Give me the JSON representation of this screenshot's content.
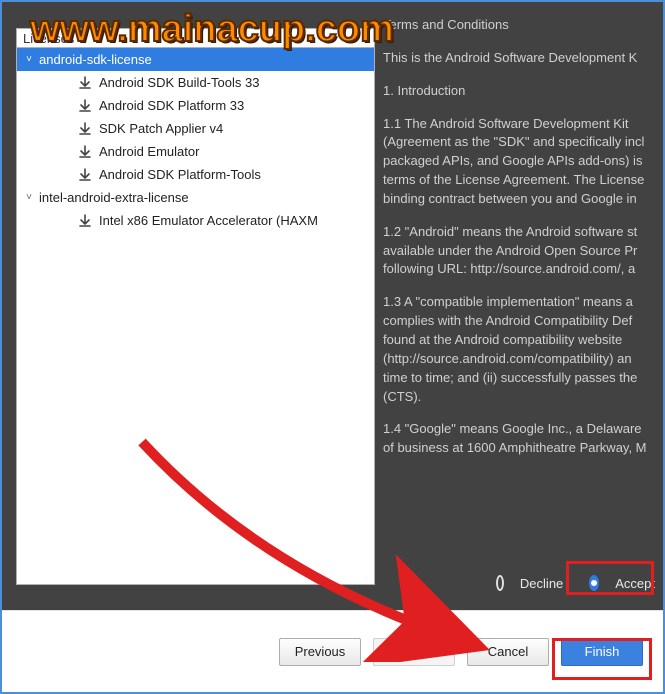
{
  "watermark": "www.mainacup.com",
  "left": {
    "title": "Licenses",
    "groups": [
      {
        "label": "android-sdk-license",
        "expanded": true,
        "selected": true,
        "items": [
          "Android SDK Build-Tools 33",
          "Android SDK Platform 33",
          "SDK Patch Applier v4",
          "Android Emulator",
          "Android SDK Platform-Tools"
        ]
      },
      {
        "label": "intel-android-extra-license",
        "expanded": true,
        "selected": false,
        "items": [
          "Intel x86 Emulator Accelerator (HAXM"
        ]
      }
    ]
  },
  "terms": {
    "heading": "Terms and Conditions",
    "line1": "This is the Android Software Development K",
    "sec1": "1. Introduction",
    "p11": "1.1 The Android Software Development Kit (Agreement as the \"SDK\" and specifically incl packaged APIs, and Google APIs add-ons) is terms of the License Agreement. The License binding contract between you and Google in",
    "p12": "1.2 \"Android\" means the Android software st available under the Android Open Source Pr following URL: http://source.android.com/, a",
    "p13": "1.3 A \"compatible implementation\" means a complies with the Android Compatibility Def found at the Android compatibility website (http://source.android.com/compatibility) an time to time; and (ii) successfully passes the (CTS).",
    "p14": "1.4 \"Google\" means Google Inc., a Delaware of business at 1600 Amphitheatre Parkway, M"
  },
  "radios": {
    "decline": "Decline",
    "accept": "Accept",
    "selected": "accept"
  },
  "buttons": {
    "previous": "Previous",
    "next": "Next",
    "cancel": "Cancel",
    "finish": "Finish"
  }
}
